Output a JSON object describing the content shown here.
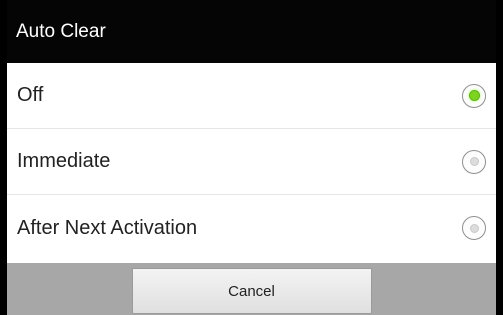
{
  "dialog": {
    "title": "Auto Clear",
    "options": [
      {
        "label": "Off",
        "selected": true
      },
      {
        "label": "Immediate",
        "selected": false
      },
      {
        "label": "After Next Activation",
        "selected": false
      }
    ],
    "cancel_label": "Cancel"
  },
  "colors": {
    "title_bar": "#050505",
    "selected_radio": "#7ed321",
    "footer": "#a7a7a7"
  }
}
